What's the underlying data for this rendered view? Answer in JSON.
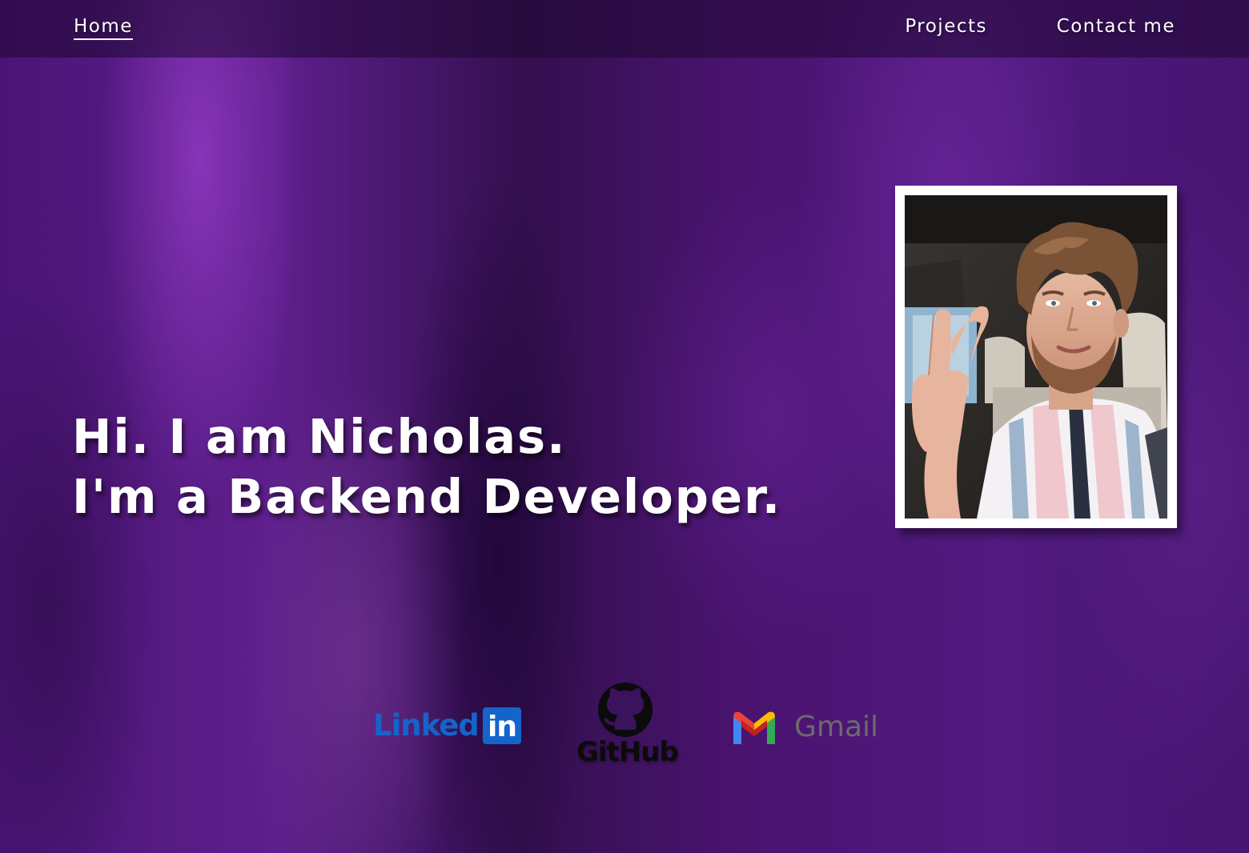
{
  "nav": {
    "home": "Home",
    "projects": "Projects",
    "contact": "Contact me"
  },
  "hero": {
    "line1": "Hi. I am Nicholas.",
    "line2": "I'm a Backend Developer."
  },
  "portrait": {
    "alt": "Photo of Nicholas"
  },
  "socials": {
    "linkedin": {
      "word": "Linked",
      "badge": "in",
      "icon": "linkedin-logo"
    },
    "github": {
      "label": "GitHub",
      "icon": "github-octocat-logo"
    },
    "gmail": {
      "label": "Gmail",
      "icon": "gmail-m-logo"
    }
  },
  "colors": {
    "background": "#4a1576",
    "linkedin_blue": "#1464cc",
    "gmail_gray": "#6b6b6b",
    "text": "#ffffff"
  }
}
